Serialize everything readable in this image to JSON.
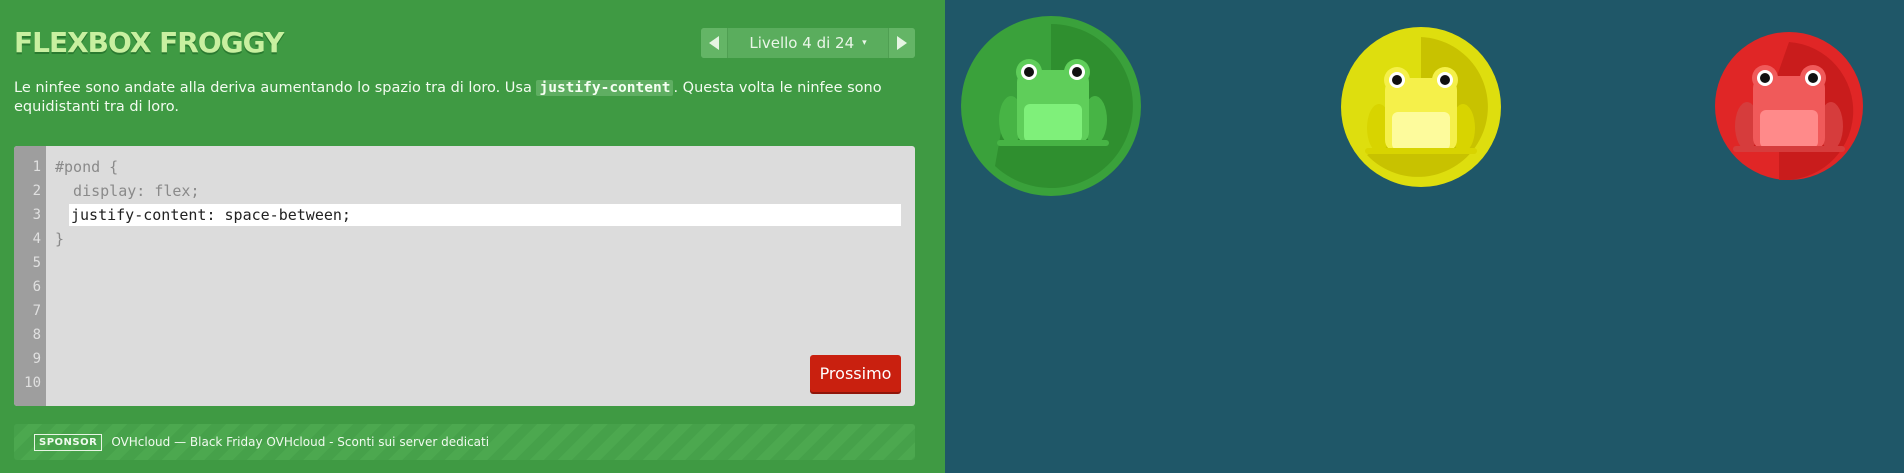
{
  "app": {
    "title": "FLEXBOX FROGGY"
  },
  "level_nav": {
    "label": "Livello 4 di 24",
    "caret": "▾"
  },
  "instructions": {
    "before": "Le ninfee sono andate alla deriva aumentando lo spazio tra di loro. Usa ",
    "code": "justify-content",
    "after": ". Questa volta le ninfee sono equidistanti tra di loro."
  },
  "editor": {
    "line_numbers": [
      "1",
      "2",
      "3",
      "4",
      "5",
      "6",
      "7",
      "8",
      "9",
      "10"
    ],
    "line1": "#pond {",
    "line2": "  display: flex;",
    "input_value": "justify-content: space-between;",
    "line4": "}",
    "next_label": "Prossimo"
  },
  "sponsor": {
    "badge": "SPONSOR",
    "text": "OVHcloud — Black Friday OVHcloud - Sconti sui server dedicati"
  },
  "pond": {
    "pads": [
      {
        "color": "green",
        "pad": "#2f8f2f",
        "pad_light": "#3aa13b",
        "frog": "#5fce5a",
        "frog_belly": "#7ff07a",
        "frog_dark": "#47b445"
      },
      {
        "color": "yellow",
        "pad": "#c8c200",
        "pad_light": "#dede0e",
        "frog": "#f5f04a",
        "frog_belly": "#fdfb9c",
        "frog_dark": "#d8d400"
      },
      {
        "color": "red",
        "pad": "#c91c1c",
        "pad_light": "#e02626",
        "frog": "#f05a5a",
        "frog_belly": "#ff8a8a",
        "frog_dark": "#d63c3c"
      }
    ]
  },
  "colors": {
    "sidebar_bg": "#3f9a43",
    "pond_bg": "#1f5768",
    "next_button": "#c9200f"
  }
}
